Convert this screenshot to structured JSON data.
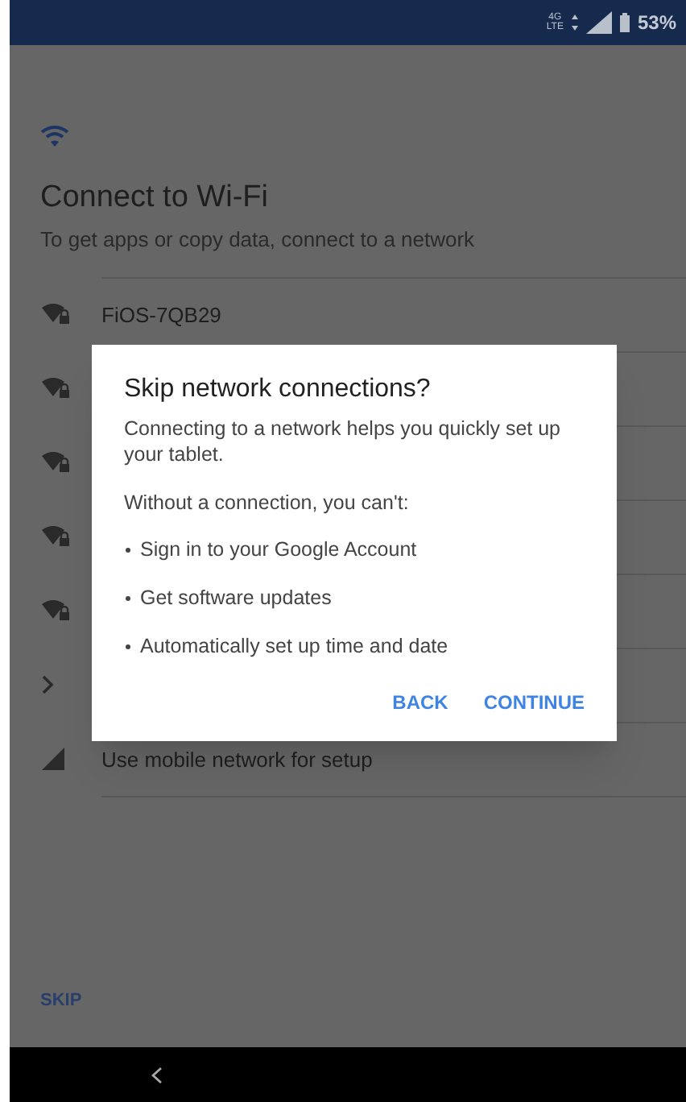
{
  "status_bar": {
    "network_top": "4G",
    "network_bottom": "LTE",
    "battery": "53%"
  },
  "header": {
    "title": "Connect to Wi-Fi",
    "subtitle": "To get apps or copy data, connect to a network"
  },
  "networks": [
    {
      "kind": "wifi",
      "name": "FiOS-7QB29"
    },
    {
      "kind": "wifi"
    },
    {
      "kind": "wifi"
    },
    {
      "kind": "wifi"
    },
    {
      "kind": "wifi"
    },
    {
      "kind": "more"
    },
    {
      "kind": "mobile",
      "name": "Use mobile network for setup"
    }
  ],
  "skip_button": "SKIP",
  "dialog": {
    "title": "Skip network connections?",
    "message": "Connecting to a network helps you quickly set up your tablet.",
    "intro": "Without a connection, you can't:",
    "bullets": [
      "Sign in to your Google Account",
      "Get software updates",
      "Automatically set up time and date"
    ],
    "buttons": [
      "BACK",
      "CONTINUE"
    ]
  }
}
